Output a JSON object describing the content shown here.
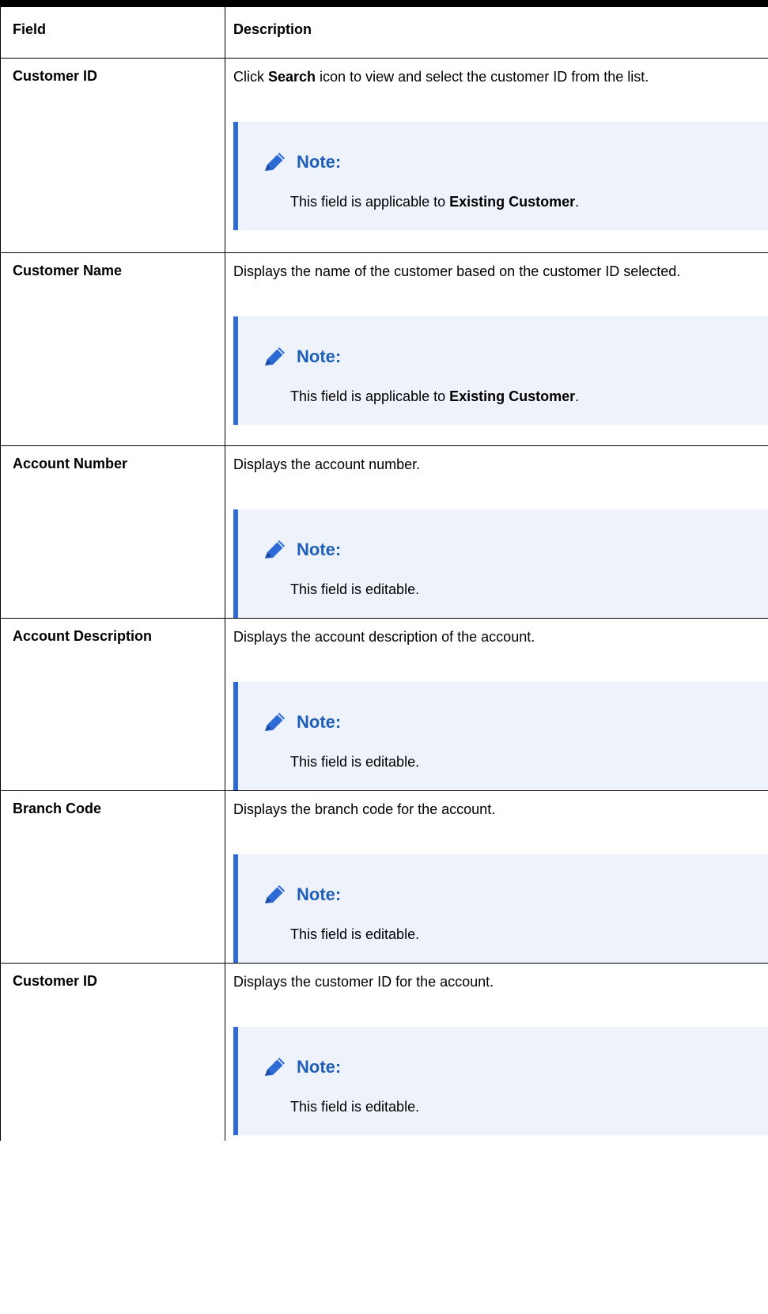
{
  "table": {
    "headers": {
      "field": "Field",
      "description": "Description"
    },
    "note_label": "Note:",
    "rows": [
      {
        "field": "Customer ID",
        "desc_parts": [
          "Click ",
          "Search",
          " icon to view and select the customer ID from the list."
        ],
        "note_parts": [
          "This field is applicable to ",
          "Existing Customer",
          "."
        ]
      },
      {
        "field": "Customer Name",
        "desc": "Displays the name of the customer based on the customer ID selected.",
        "note_parts": [
          "This field is applicable to ",
          "Existing Customer",
          "."
        ]
      },
      {
        "field": "Account Number",
        "desc": "Displays the account number.",
        "note": "This field is editable."
      },
      {
        "field": "Account Description",
        "desc": "Displays the account description of the account.",
        "note": "This field is editable."
      },
      {
        "field": "Branch Code",
        "desc": "Displays the branch code for the account.",
        "note": "This field is editable."
      },
      {
        "field": "Customer ID",
        "desc": "Displays the customer ID for the account.",
        "note": "This field is editable."
      }
    ]
  },
  "icons": {
    "note": "pencil-icon"
  },
  "colors": {
    "note_accent": "#2e6ad6",
    "note_label": "#1f5fb6",
    "note_background": "#eef3fb"
  }
}
